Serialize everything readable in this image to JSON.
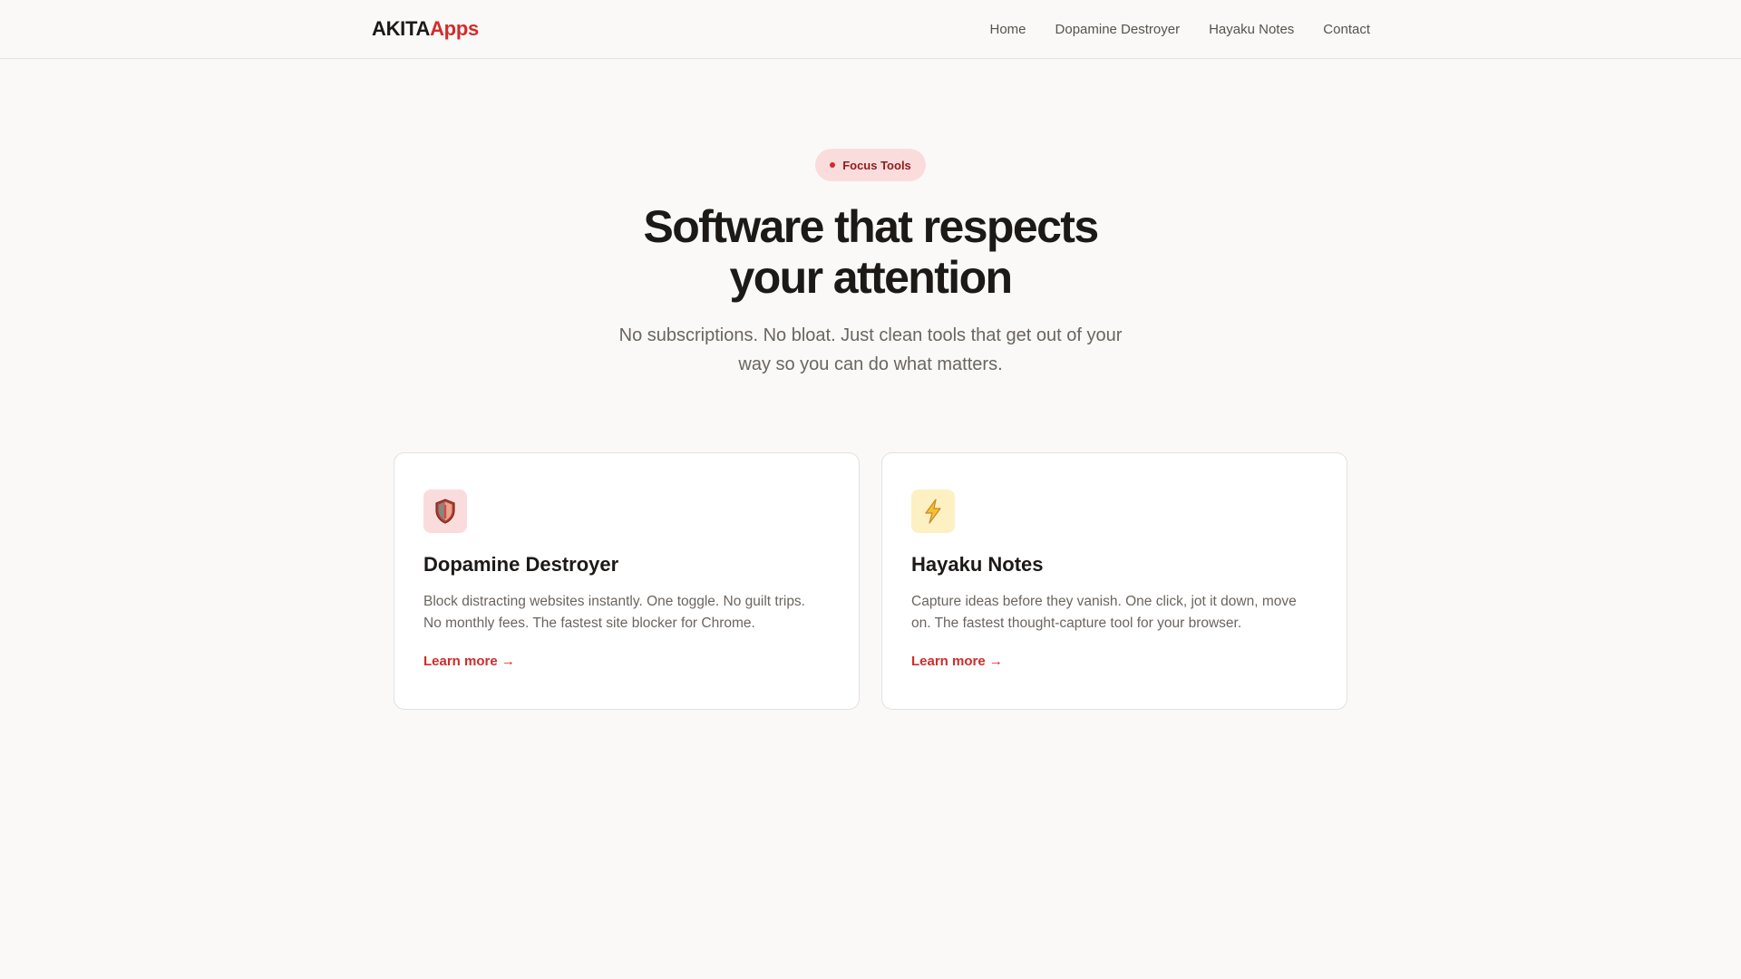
{
  "nav": {
    "logo_main": "AKITA",
    "logo_accent": "Apps",
    "links": [
      "Home",
      "Dopamine Destroyer",
      "Hayaku Notes",
      "Contact"
    ]
  },
  "hero": {
    "badge": "Focus Tools",
    "title_lines": [
      "Software that respects",
      "your attention"
    ],
    "subtitle_lines": [
      "No subscriptions. No bloat. Just clean tools that get out of your",
      "way so you can do what matters."
    ]
  },
  "cards": [
    {
      "icon": "shield-icon",
      "icon_bg": "#fbdcdc",
      "title": "Dopamine Destroyer",
      "desc_lines": [
        "Block distracting websites instantly. One toggle. No guilt trips.",
        "No monthly fees. The fastest site blocker for Chrome."
      ],
      "link": "Learn more →"
    },
    {
      "icon": "lightning-bolt-icon",
      "icon_bg": "#fdf0c2",
      "title": "Hayaku Notes",
      "desc_lines": [
        "Capture ideas before they vanish. One click, jot it down, move",
        "on. The fastest thought-capture tool for your browser."
      ],
      "link": "Learn more →"
    }
  ],
  "colors": {
    "accent": "#d42a2a",
    "background": "#faf9f7",
    "text": "#1c1917",
    "muted": "#6b6560"
  }
}
